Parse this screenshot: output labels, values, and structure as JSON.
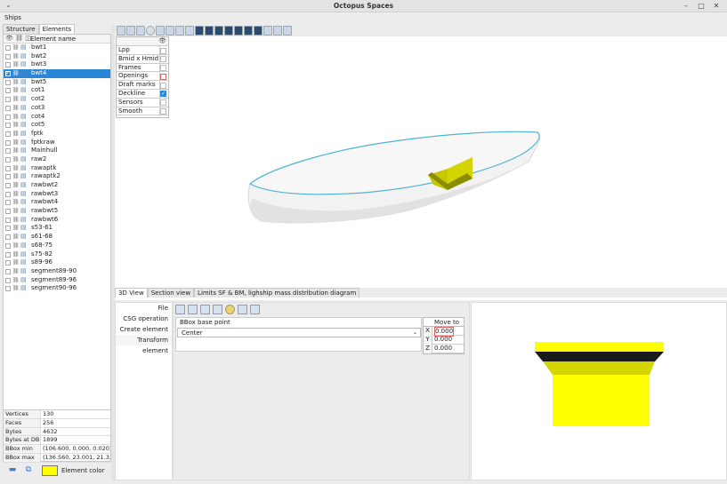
{
  "window": {
    "title": "Octopus Spaces",
    "minimize": "–",
    "maximize": "□",
    "close": "✕",
    "menu_chevron": "⌄"
  },
  "menu": {
    "items": [
      "Ships"
    ]
  },
  "left_tabs": [
    "Structure",
    "Elements"
  ],
  "tree": {
    "column_header": "Element name",
    "rows": [
      {
        "name": "bwt1",
        "checked": false
      },
      {
        "name": "bwt2",
        "checked": false
      },
      {
        "name": "bwt3",
        "checked": false
      },
      {
        "name": "bwt4",
        "checked": true,
        "selected": true
      },
      {
        "name": "bwt5",
        "checked": false
      },
      {
        "name": "cot1",
        "checked": false
      },
      {
        "name": "cot2",
        "checked": false
      },
      {
        "name": "cot3",
        "checked": false
      },
      {
        "name": "cot4",
        "checked": false
      },
      {
        "name": "cot5",
        "checked": false
      },
      {
        "name": "fptk",
        "checked": false
      },
      {
        "name": "fptkraw",
        "checked": false
      },
      {
        "name": "Mainhull",
        "checked": false
      },
      {
        "name": "raw2",
        "checked": false
      },
      {
        "name": "rawaptk",
        "checked": false
      },
      {
        "name": "rawaptk2",
        "checked": false
      },
      {
        "name": "rawbwt2",
        "checked": false
      },
      {
        "name": "rawbwt3",
        "checked": false
      },
      {
        "name": "rawbwt4",
        "checked": false
      },
      {
        "name": "rawbwt5",
        "checked": false
      },
      {
        "name": "rawbwt6",
        "checked": false
      },
      {
        "name": "s53-61",
        "checked": false
      },
      {
        "name": "s61-68",
        "checked": false
      },
      {
        "name": "s68-75",
        "checked": false
      },
      {
        "name": "s75-82",
        "checked": false
      },
      {
        "name": "s89-96",
        "checked": false
      },
      {
        "name": "segment89-90",
        "checked": false
      },
      {
        "name": "segment89-96",
        "checked": false
      },
      {
        "name": "segment90-96",
        "checked": false
      }
    ]
  },
  "properties": [
    {
      "key": "Vertices",
      "value": "130"
    },
    {
      "key": "Faces",
      "value": "256"
    },
    {
      "key": "Bytes",
      "value": "4632"
    },
    {
      "key": "Bytes at DB",
      "value": "1899"
    },
    {
      "key": "BBox min",
      "value": "(106.600, 0.000, 0.020)"
    },
    {
      "key": "BBox max",
      "value": "(136.560, 23.001, 21.32..."
    }
  ],
  "element_color": {
    "label": "Element color",
    "color": "#ffff00"
  },
  "layers": [
    {
      "name": "Lpp",
      "checked": false
    },
    {
      "name": "Bmid x Hmid",
      "checked": false
    },
    {
      "name": "Frames",
      "checked": false
    },
    {
      "name": "Openings",
      "checked": false
    },
    {
      "name": "Draft marks",
      "checked": false
    },
    {
      "name": "Deckline",
      "checked": true
    },
    {
      "name": "Sensors",
      "checked": false
    },
    {
      "name": "Smooth",
      "checked": false
    }
  ],
  "view_tabs": [
    "3D View",
    "Section view",
    "Limits SF & BM, lighship mass distribution diagram"
  ],
  "side_menu": [
    "File",
    "CSG operation",
    "Create element",
    "Transform element"
  ],
  "bbox": {
    "label": "BBox base point",
    "selected": "Center",
    "arrow": "⌄"
  },
  "move_to": {
    "header": "Move to",
    "rows": [
      {
        "axis": "X",
        "value": "0.000"
      },
      {
        "axis": "Y",
        "value": "0.000"
      },
      {
        "axis": "Z",
        "value": "0.000"
      }
    ]
  },
  "colors": {
    "accent": "#2a86d6",
    "element": "#ffff00",
    "hull": "#f2f2f2",
    "deckline": "#4fb4d4"
  }
}
